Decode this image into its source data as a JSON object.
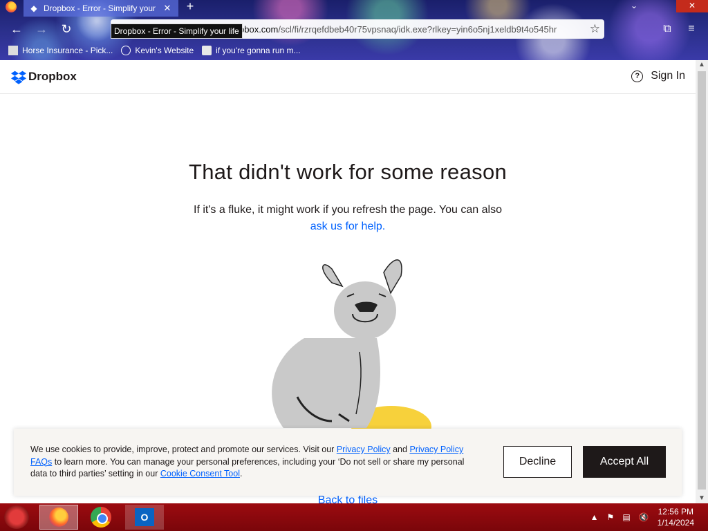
{
  "browser": {
    "tab_title": "Dropbox - Error - Simplify your",
    "tab_tooltip": "Dropbox - Error - Simplify your life",
    "url_host": "obox.com",
    "url_path": "/scl/fi/rzrqefdbeb40r75vpsnaq/idk.exe?rlkey=yin6o5nj1xeldb9t4o545hr",
    "bookmarks": [
      "Horse Insurance - Pick...",
      "Kevin's Website",
      "if you're gonna run m..."
    ]
  },
  "site": {
    "logo_text": "Dropbox",
    "sign_in": "Sign In",
    "brand_color": "#0061fe"
  },
  "error": {
    "headline": "That didn't work for some reason",
    "body": "If it's a fluke, it might work if you refresh the page. You can also",
    "help_link": "ask us for help.",
    "back_link": "Back to files"
  },
  "cookie": {
    "text_1": "We use cookies to provide, improve, protect and promote our services. Visit our",
    "privacy_policy": "Privacy Policy",
    "text_2": "and",
    "privacy_faqs": "Privacy Policy FAQs",
    "text_3": "to learn more. You can manage your personal preferences, including your ‘Do not sell or share my personal data to third parties’ setting in our",
    "consent_tool": "Cookie Consent Tool",
    "text_4": ".",
    "decline": "Decline",
    "accept": "Accept All"
  },
  "taskbar": {
    "time": "12:56 PM",
    "date": "1/14/2024"
  }
}
